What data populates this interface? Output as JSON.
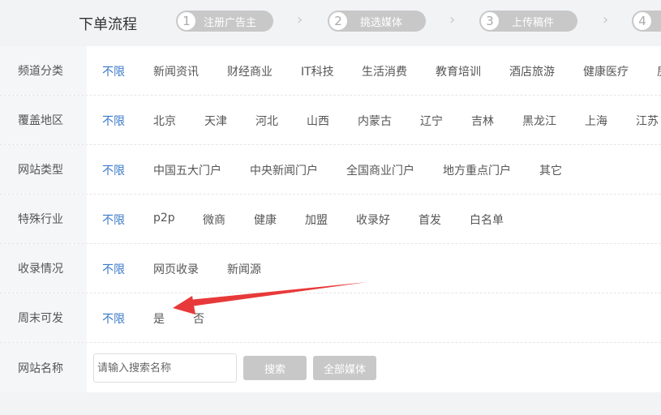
{
  "steps": {
    "title": "下单流程",
    "items": [
      {
        "num": "1",
        "label": "注册广告主"
      },
      {
        "num": "2",
        "label": "挑选媒体"
      },
      {
        "num": "3",
        "label": "上传稿件"
      },
      {
        "num": "4",
        "label": ""
      }
    ],
    "separator": "›"
  },
  "filters": [
    {
      "label": "频道分类",
      "options": [
        "不限",
        "新闻资讯",
        "财经商业",
        "IT科技",
        "生活消费",
        "教育培训",
        "酒店旅游",
        "健康医疗",
        "房"
      ]
    },
    {
      "label": "覆盖地区",
      "options": [
        "不限",
        "北京",
        "天津",
        "河北",
        "山西",
        "内蒙古",
        "辽宁",
        "吉林",
        "黑龙江",
        "上海",
        "江苏"
      ]
    },
    {
      "label": "网站类型",
      "options": [
        "不限",
        "中国五大门户",
        "中央新闻门户",
        "全国商业门户",
        "地方重点门户",
        "其它"
      ]
    },
    {
      "label": "特殊行业",
      "options": [
        "不限",
        "p2p",
        "微商",
        "健康",
        "加盟",
        "收录好",
        "首发",
        "白名单"
      ]
    },
    {
      "label": "收录情况",
      "options": [
        "不限",
        "网页收录",
        "新闻源"
      ]
    },
    {
      "label": "周末可发",
      "options": [
        "不限",
        "是",
        "否"
      ]
    }
  ],
  "search": {
    "label": "网站名称",
    "placeholder": "请输入搜索名称",
    "search_button": "搜索",
    "all_media_button": "全部媒体"
  },
  "colors": {
    "active": "#3a79c8",
    "arrow": "#e8393a",
    "button": "#c8c8c8"
  }
}
